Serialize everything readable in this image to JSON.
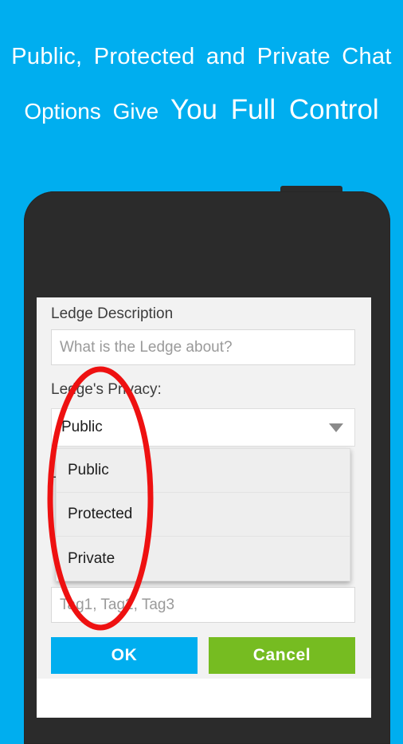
{
  "promo": {
    "background_color": "#00AEEF",
    "headline_line_1": "Public, Protected and Private Chat",
    "headline_line_2_small_a": "Options Give",
    "headline_line_2_big": "You Full Control"
  },
  "device": {
    "type": "smartphone-mockup",
    "body_color": "#2b2b2b",
    "camera_icon": "camera-dot",
    "speaker_icon": "speaker-grille"
  },
  "dialog": {
    "description_label": "Ledge Description",
    "description_placeholder": "What is the Ledge about?",
    "description_value": "",
    "privacy_label": "Ledge's Privacy:",
    "privacy_selected": "Public",
    "privacy_options": [
      "Public",
      "Protected",
      "Private"
    ],
    "tags_label": "Ledge's Tags:",
    "tags_placeholder": "Tag1, Tag2, Tag3",
    "tags_value": "",
    "caret_icon": "chevron-down-icon",
    "ok_label": "OK",
    "cancel_label": "Cancel",
    "ok_color": "#00AEEF",
    "cancel_color": "#76BC21"
  },
  "annotation": {
    "shape": "ellipse",
    "color": "#EE1111",
    "stroke_width": 7
  }
}
